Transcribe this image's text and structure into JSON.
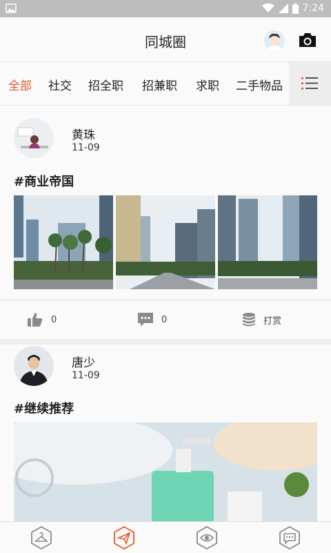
{
  "status": {
    "time": "7:24"
  },
  "header": {
    "title": "同城圈"
  },
  "tabs": [
    {
      "label": "全部"
    },
    {
      "label": "社交"
    },
    {
      "label": "招全职"
    },
    {
      "label": "招兼职"
    },
    {
      "label": "求职"
    },
    {
      "label": "二手物品"
    }
  ],
  "posts": [
    {
      "name": "黄珠",
      "date": "11-09",
      "title": "#商业帝国",
      "likes": "0",
      "comments": "0",
      "reward_label": "打赏"
    },
    {
      "name": "唐少",
      "date": "11-09",
      "title": "#继续推荐"
    }
  ],
  "colors": {
    "accent": "#e4572e",
    "icon_gray": "#8a8a8a"
  },
  "icons": [
    "image-icon",
    "wifi-icon",
    "signal-icon",
    "battery-icon",
    "user-avatar-icon",
    "camera-icon",
    "list-icon",
    "thumbs-up-icon",
    "comment-icon",
    "coins-icon",
    "hanger-icon",
    "paper-plane-icon",
    "eye-icon",
    "chat-icon"
  ]
}
